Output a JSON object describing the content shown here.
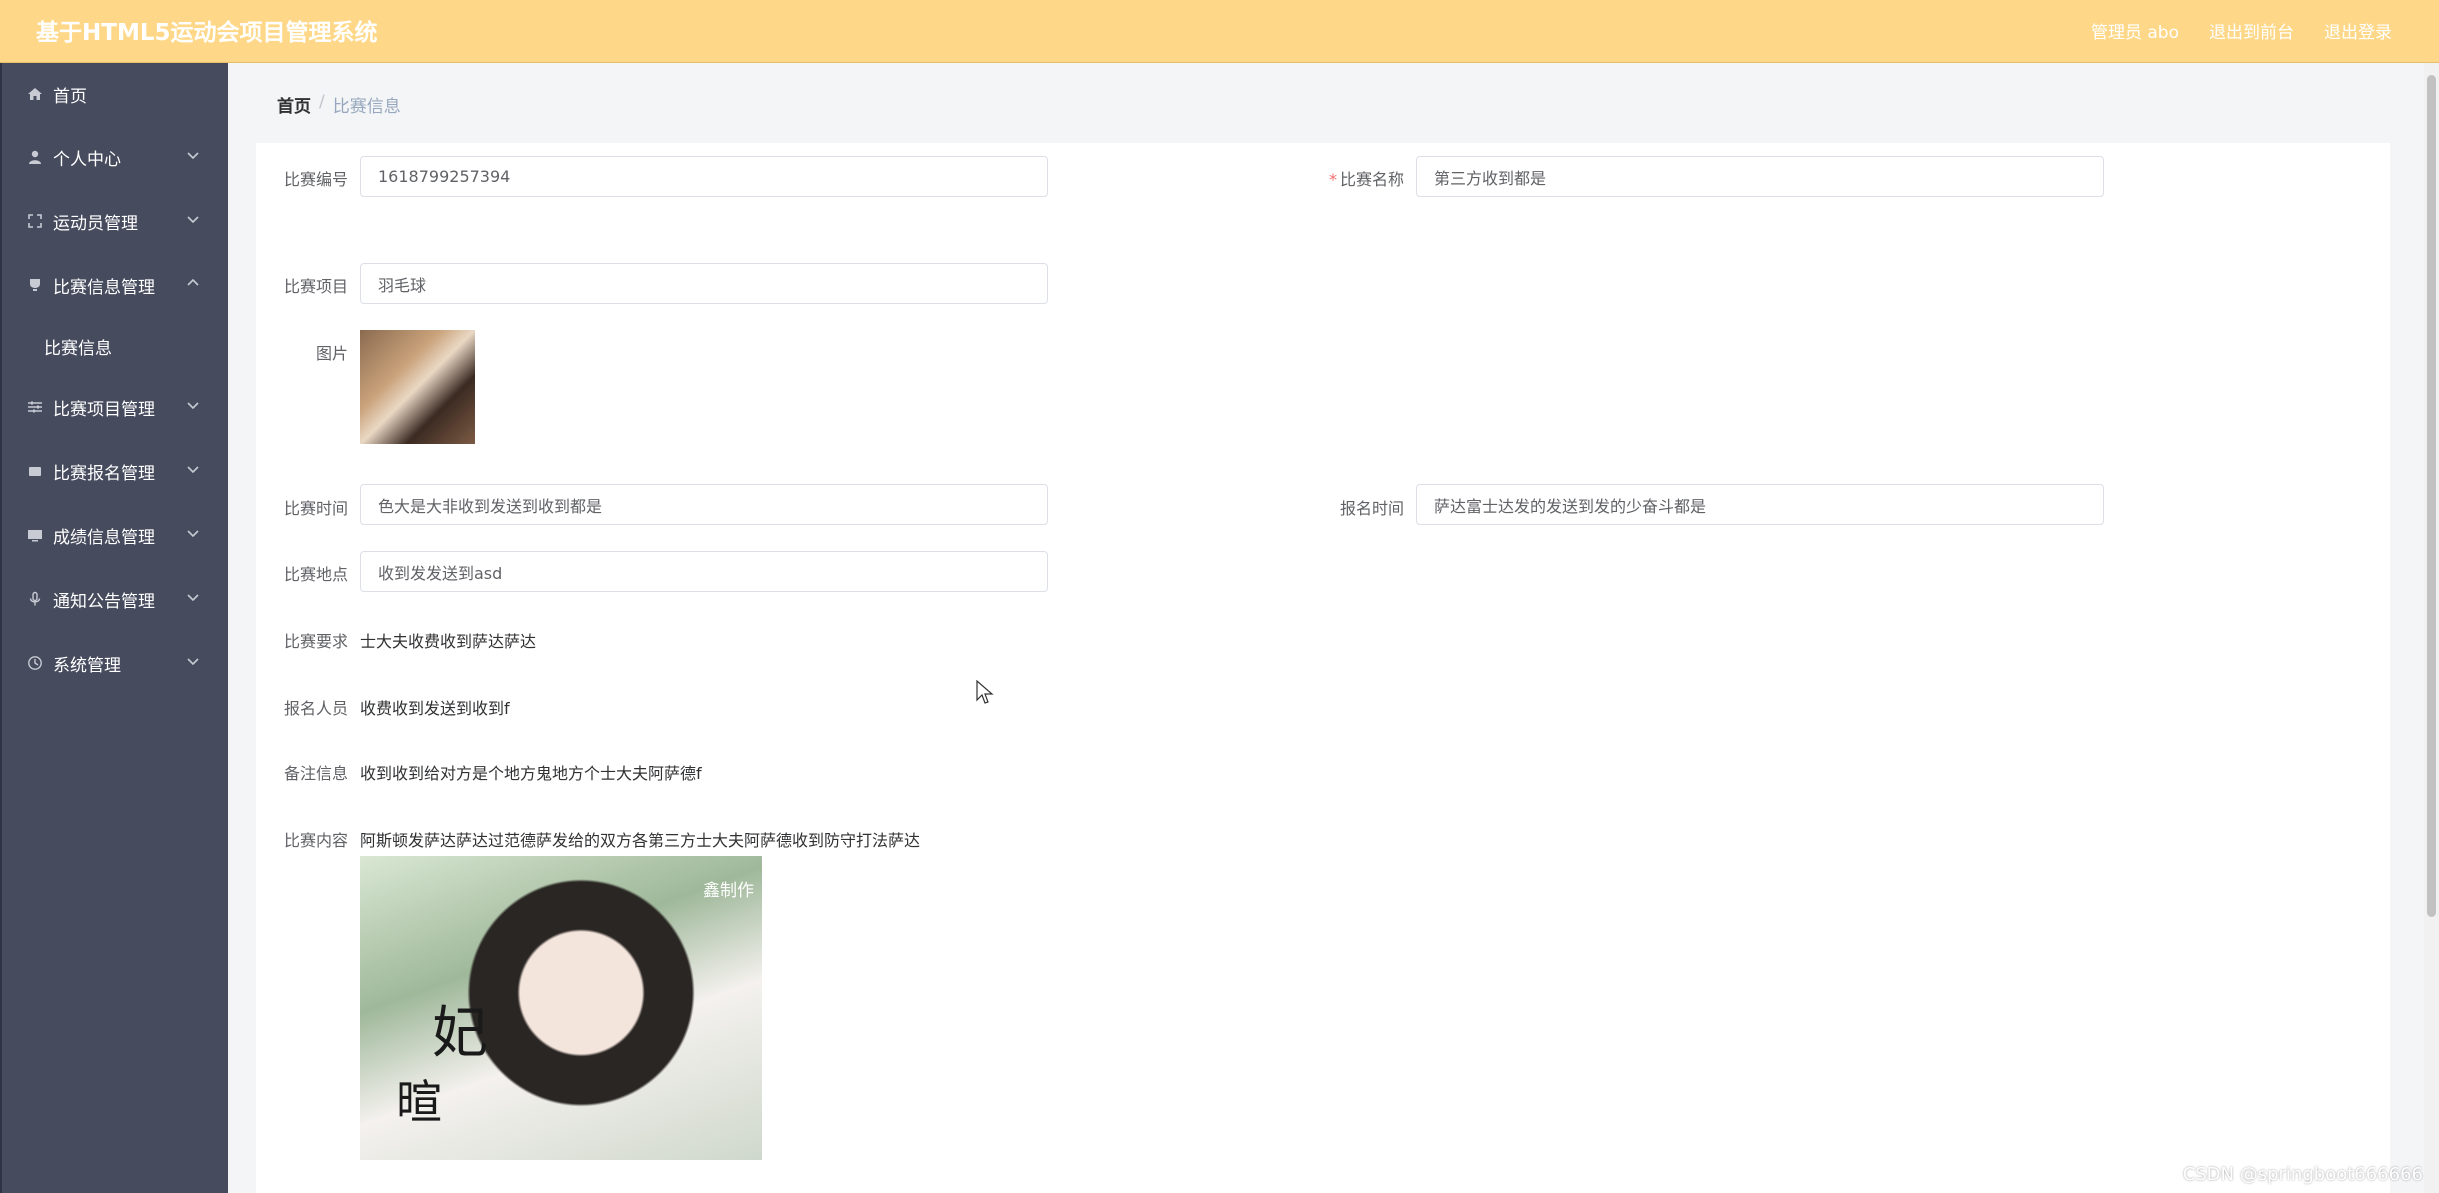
{
  "header": {
    "title": "基于HTML5运动会项目管理系统",
    "admin": "管理员 abo",
    "to_front": "退出到前台",
    "logout": "退出登录"
  },
  "sidebar": {
    "items": [
      {
        "label": "首页",
        "icon": "home-icon",
        "expanded": false
      },
      {
        "label": "个人中心",
        "icon": "user-icon",
        "expanded": false
      },
      {
        "label": "运动员管理",
        "icon": "fullscreen-icon",
        "expanded": false
      },
      {
        "label": "比赛信息管理",
        "icon": "trophy-icon",
        "expanded": true
      },
      {
        "label": "比赛项目管理",
        "icon": "sliders-icon",
        "expanded": false
      },
      {
        "label": "比赛报名管理",
        "icon": "tray-icon",
        "expanded": false
      },
      {
        "label": "成绩信息管理",
        "icon": "monitor-icon",
        "expanded": false
      },
      {
        "label": "通知公告管理",
        "icon": "microphone-icon",
        "expanded": false
      },
      {
        "label": "系统管理",
        "icon": "clock-icon",
        "expanded": false
      }
    ],
    "submenu": {
      "label": "比赛信息"
    }
  },
  "breadcrumb": {
    "home": "首页",
    "separator": "/",
    "current": "比赛信息"
  },
  "form": {
    "match_no_label": "比赛编号",
    "match_no": "1618799257394",
    "match_name_label": "比赛名称",
    "match_name_required": "*",
    "match_name": "第三方收到都是",
    "project_label": "比赛项目",
    "project": "羽毛球",
    "image_label": "图片",
    "match_time_label": "比赛时间",
    "match_time": "色大是大非收到发送到收到都是",
    "signup_time_label": "报名时间",
    "signup_time": "萨达富士达发的发送到发的少奋斗都是",
    "location_label": "比赛地点",
    "location": "收到发发送到asd",
    "requirement_label": "比赛要求",
    "requirement": "士大夫收费收到萨达萨达",
    "participants_label": "报名人员",
    "participants": "收费收到发送到收到f",
    "remark_label": "备注信息",
    "remark": "收到收到给对方是个地方鬼地方个士大夫阿萨德f",
    "content_label": "比赛内容",
    "content": "阿斯顿发萨达萨达过范德萨发给的双方各第三方士大夫阿萨德收到防守打法萨达",
    "content_image_caption_1": "妃",
    "content_image_caption_2": "暄",
    "content_image_mark": "鑫制作"
  },
  "watermark": "CSDN @springboot666666"
}
